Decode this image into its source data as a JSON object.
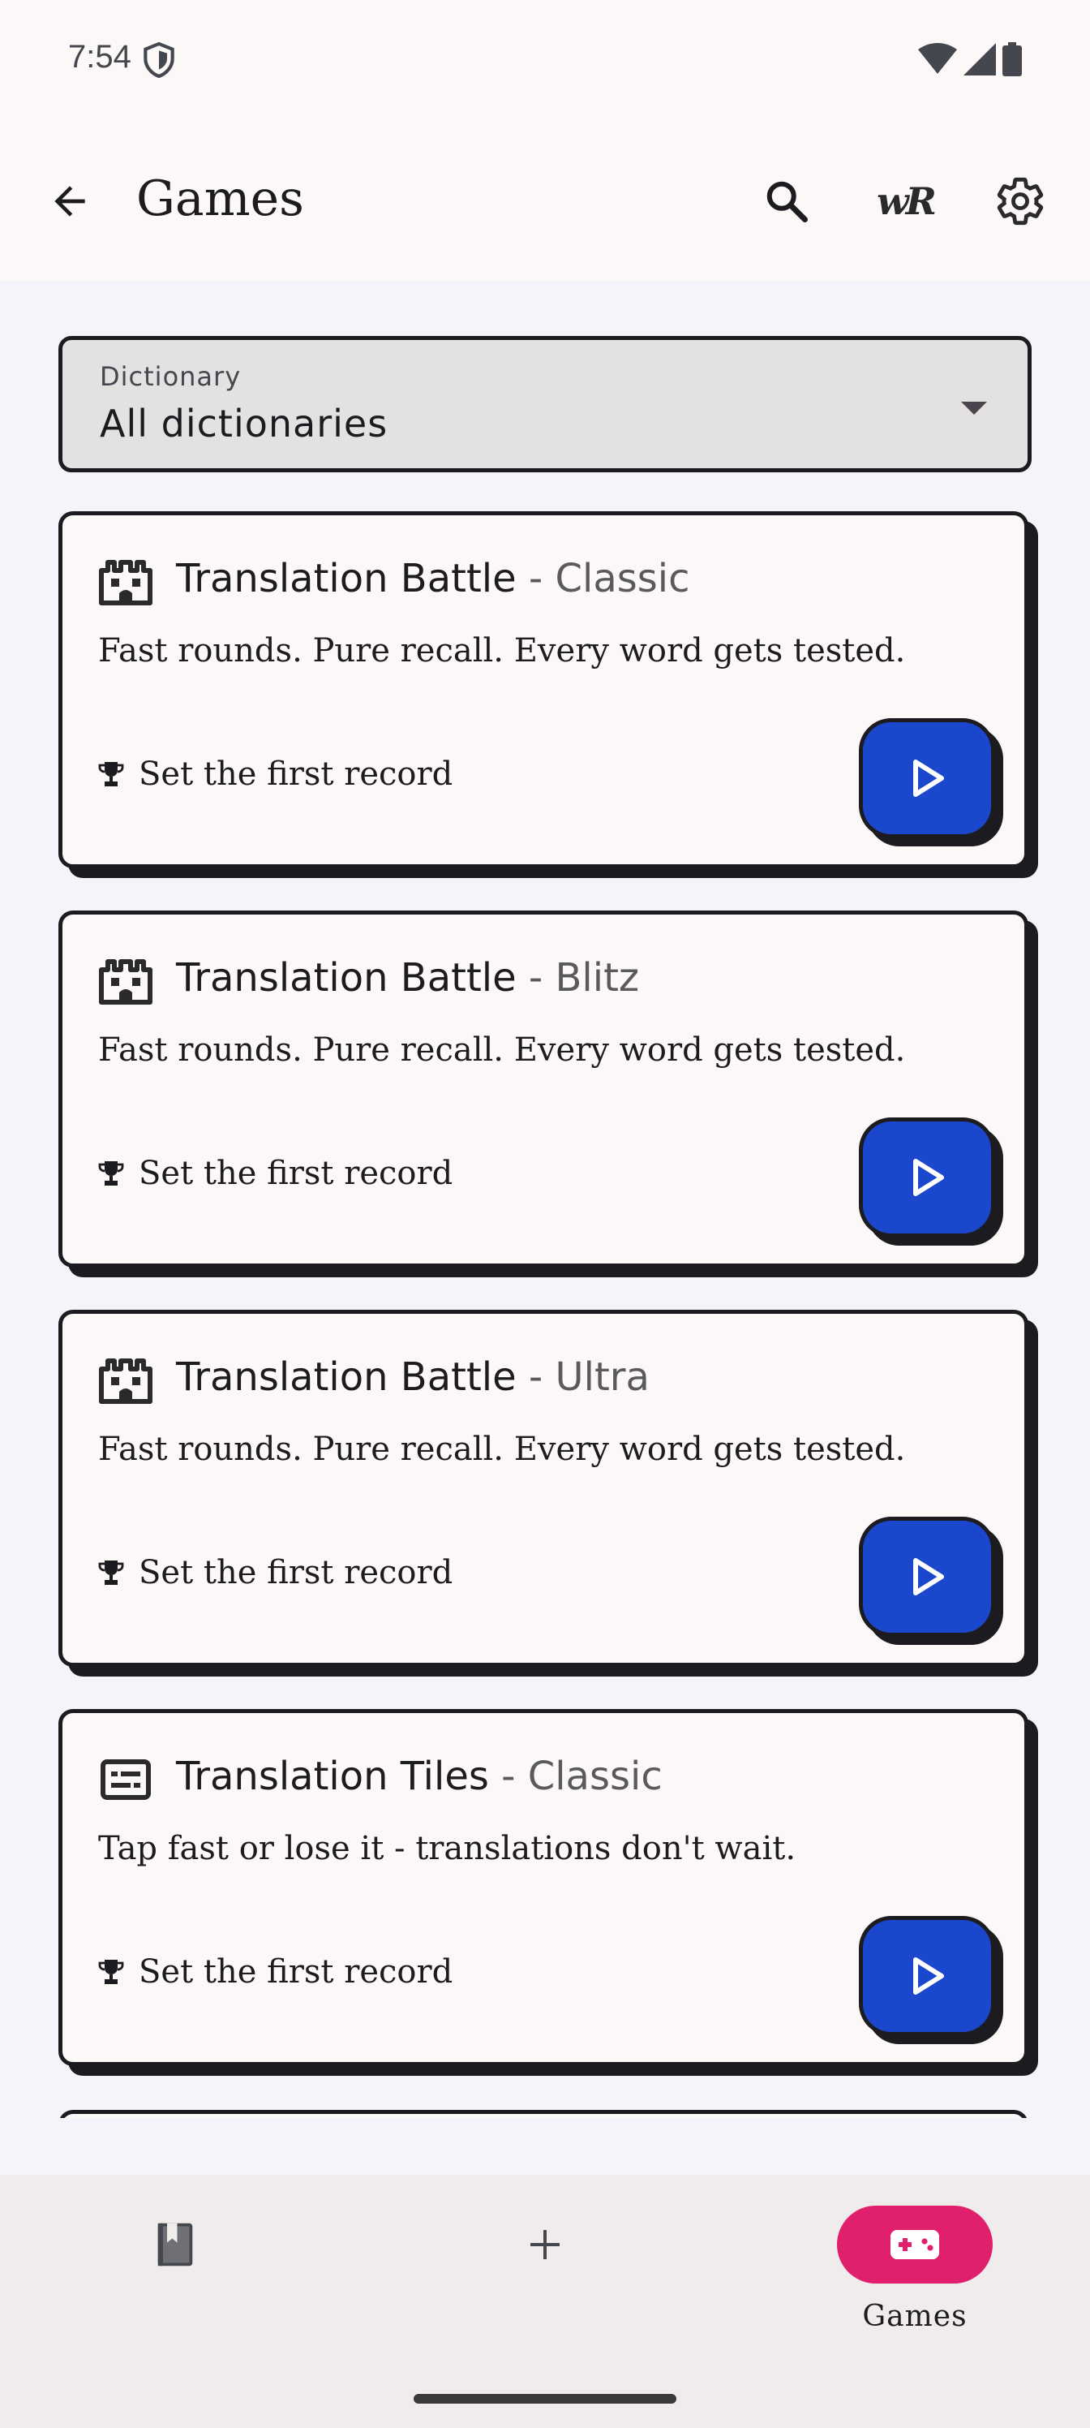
{
  "status_bar": {
    "time": "7:54",
    "icons": [
      "shield-icon",
      "wifi-icon",
      "signal-icon",
      "battery-icon"
    ]
  },
  "app_bar": {
    "title": "Games",
    "actions": [
      "search-icon",
      "wr-logo-icon",
      "gear-icon"
    ],
    "logo_text": "wR"
  },
  "dictionary_select": {
    "label": "Dictionary",
    "value": "All dictionaries"
  },
  "games": [
    {
      "title": "Translation Battle",
      "mode": " - Classic",
      "description": "Fast rounds. Pure recall. Every word gets tested.",
      "record": "Set the first record",
      "icon": "castle-icon"
    },
    {
      "title": "Translation Battle",
      "mode": " - Blitz",
      "description": "Fast rounds. Pure recall. Every word gets tested.",
      "record": "Set the first record",
      "icon": "castle-icon"
    },
    {
      "title": "Translation Battle",
      "mode": " - Ultra",
      "description": "Fast rounds. Pure recall. Every word gets tested.",
      "record": "Set the first record",
      "icon": "castle-icon"
    },
    {
      "title": "Translation Tiles",
      "mode": " - Classic",
      "description": "Tap fast or lose it - translations don't wait.",
      "record": "Set the first record",
      "icon": "tiles-icon"
    }
  ],
  "bottom_nav": {
    "items": [
      {
        "label": "",
        "icon": "bookmark-book-icon"
      },
      {
        "label": "",
        "icon": "plus-icon"
      },
      {
        "label": "Games",
        "icon": "gamepad-icon",
        "active": true
      }
    ]
  },
  "colors": {
    "accent_play": "#1a47cc",
    "nav_active": "#e0206c",
    "border": "#1c1b1f",
    "card_bg": "#fbf8f7"
  }
}
